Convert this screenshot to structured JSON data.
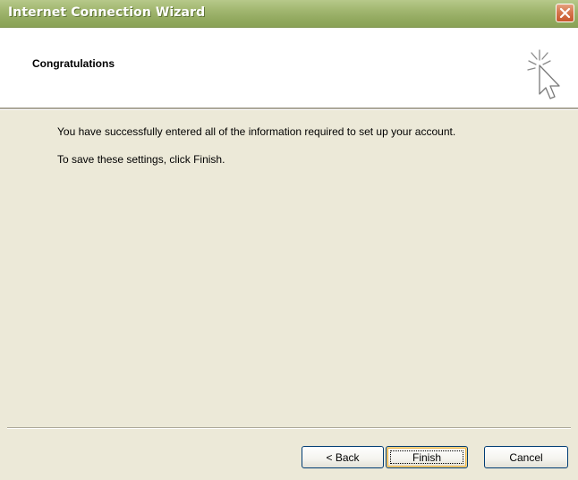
{
  "window": {
    "title": "Internet Connection Wizard",
    "close_icon": "close-icon"
  },
  "header": {
    "title": "Congratulations",
    "icon": "cursor-sparkle-icon"
  },
  "body": {
    "line1": "You have successfully entered all of the information required to set up your account.",
    "line2": "To save these settings, click Finish."
  },
  "buttons": {
    "back": "< Back",
    "finish": "Finish",
    "cancel": "Cancel"
  },
  "colors": {
    "titlebar": "#A3B872",
    "close_button": "#D6774F",
    "dialog_background": "#ECE9D8",
    "header_background": "#FFFFFF"
  }
}
